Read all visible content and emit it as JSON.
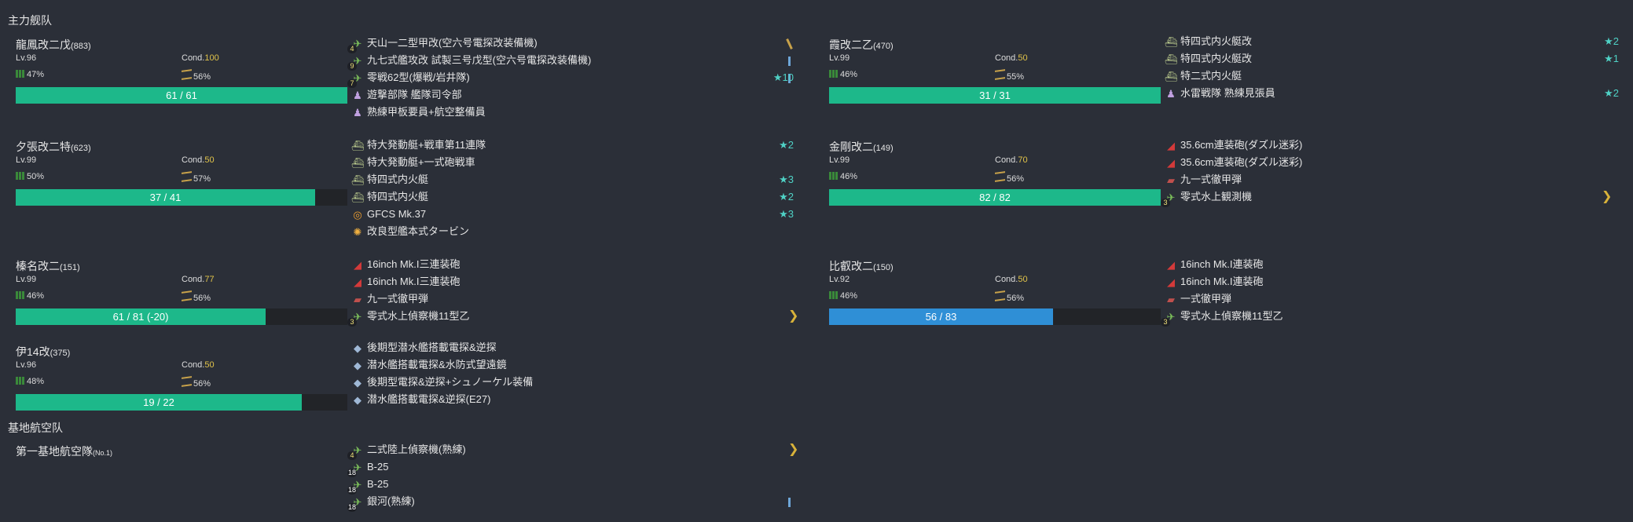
{
  "sections": {
    "main_fleet": "主力舰队",
    "base_air": "基地航空队"
  },
  "ships": [
    {
      "name": "龍鳳改二戊",
      "id": "(883)",
      "lv": "Lv.96",
      "cond_label": "Cond.",
      "cond": "100",
      "fuel": "47%",
      "ammo": "56%",
      "hp_text": "61 / 61",
      "hp_fraction": 1.0,
      "hp_color": "green",
      "equip": [
        {
          "icon": "plane-icon",
          "slot": "4",
          "name": "天山一二型甲改(空六号電探改装備機)",
          "prof": "slash"
        },
        {
          "icon": "plane-icon",
          "slot": "9",
          "name": "九七式艦攻改 試製三号戊型(空六号電探改装備機)",
          "prof": "bar"
        },
        {
          "icon": "plane-icon",
          "slot": "7",
          "name": "零戦62型(爆戦/岩井隊)",
          "prof": "bar",
          "stars": "★10"
        },
        {
          "icon": "crew-icon",
          "name": "遊撃部隊 艦隊司令部"
        },
        {
          "icon": "crew-icon",
          "name": "熟練甲板要員+航空整備員"
        }
      ]
    },
    {
      "name": "夕張改二特",
      "id": "(623)",
      "lv": "Lv.99",
      "cond_label": "Cond.",
      "cond": "50",
      "fuel": "50%",
      "ammo": "57%",
      "hp_text": "37 / 41",
      "hp_fraction": 0.9024,
      "hp_color": "green",
      "equip": [
        {
          "icon": "boat-icon",
          "name": "特大発動艇+戦車第11連隊",
          "stars": "★2"
        },
        {
          "icon": "boat-icon",
          "name": "特大発動艇+一式砲戦車"
        },
        {
          "icon": "boat-icon",
          "name": "特四式内火艇",
          "stars": "★3"
        },
        {
          "icon": "boat-icon",
          "name": "特四式内火艇",
          "stars": "★2"
        },
        {
          "icon": "radar-icon",
          "name": "GFCS Mk.37",
          "stars": "★3"
        },
        {
          "icon": "engine-icon",
          "name": "改良型艦本式タービン"
        }
      ]
    },
    {
      "name": "榛名改二",
      "id": "(151)",
      "lv": "Lv.99",
      "cond_label": "Cond.",
      "cond": "77",
      "fuel": "46%",
      "ammo": "56%",
      "hp_text": "61 / 81 (-20)",
      "hp_fraction": 0.7531,
      "hp_color": "green",
      "equip": [
        {
          "icon": "gun-icon",
          "name": "16inch Mk.I三連装砲"
        },
        {
          "icon": "gun-icon",
          "name": "16inch Mk.I三連装砲"
        },
        {
          "icon": "shell-icon",
          "name": "九一式徹甲弾"
        },
        {
          "icon": "seaplane-icon",
          "slot": "3",
          "name": "零式水上偵察機11型乙",
          "prof": "chevron"
        }
      ]
    },
    {
      "name": "伊14改",
      "id": "(375)",
      "lv": "Lv.96",
      "cond_label": "Cond.",
      "cond": "50",
      "fuel": "48%",
      "ammo": "56%",
      "hp_text": "19 / 22",
      "hp_fraction": 0.8636,
      "hp_color": "green",
      "equip": [
        {
          "icon": "sonar-icon",
          "name": "後期型潜水艦搭載電探&逆探"
        },
        {
          "icon": "sonar-icon",
          "name": "潜水艦搭載電探&水防式望遠鏡"
        },
        {
          "icon": "sonar-icon",
          "name": "後期型電探&逆探+シュノーケル装備"
        },
        {
          "icon": "sonar-icon",
          "name": "潜水艦搭載電探&逆探(E27)"
        }
      ]
    },
    {
      "name": "霞改二乙",
      "id": "(470)",
      "lv": "Lv.99",
      "cond_label": "Cond.",
      "cond": "50",
      "fuel": "46%",
      "ammo": "55%",
      "hp_text": "31 / 31",
      "hp_fraction": 1.0,
      "hp_color": "green",
      "equip": [
        {
          "icon": "boat-icon",
          "name": "特四式内火艇改",
          "stars": "★2"
        },
        {
          "icon": "boat-icon",
          "name": "特四式内火艇改",
          "stars": "★1"
        },
        {
          "icon": "boat-icon",
          "name": "特二式内火艇"
        },
        {
          "icon": "crew-icon",
          "name": "水雷戦隊 熟練見張員",
          "stars": "★2"
        }
      ]
    },
    {
      "name": "金剛改二",
      "id": "(149)",
      "lv": "Lv.99",
      "cond_label": "Cond.",
      "cond": "70",
      "fuel": "46%",
      "ammo": "56%",
      "hp_text": "82 / 82",
      "hp_fraction": 1.0,
      "hp_color": "green",
      "equip": [
        {
          "icon": "gun-icon",
          "name": "35.6cm連装砲(ダズル迷彩)"
        },
        {
          "icon": "gun-icon",
          "name": "35.6cm連装砲(ダズル迷彩)"
        },
        {
          "icon": "shell-icon",
          "name": "九一式徹甲弾"
        },
        {
          "icon": "seaplane-icon",
          "slot": "3",
          "name": "零式水上観測機",
          "prof": "chevron"
        }
      ]
    },
    {
      "name": "比叡改二",
      "id": "(150)",
      "lv": "Lv.92",
      "cond_label": "Cond.",
      "cond": "50",
      "fuel": "46%",
      "ammo": "56%",
      "hp_text": "56 / 83",
      "hp_fraction": 0.6747,
      "hp_color": "blue",
      "equip": [
        {
          "icon": "gun-icon",
          "name": "16inch Mk.I連装砲"
        },
        {
          "icon": "gun-icon",
          "name": "16inch Mk.I連装砲"
        },
        {
          "icon": "shell-icon",
          "name": "一式徹甲弾"
        },
        {
          "icon": "seaplane-icon",
          "slot": "3",
          "name": "零式水上偵察機11型乙"
        }
      ]
    }
  ],
  "air_base": {
    "name": "第一基地航空隊",
    "sub": "(No.1)",
    "equip": [
      {
        "icon": "plane-icon",
        "slot": "4",
        "name": "二式陸上偵察機(熟練)",
        "prof": "chevron"
      },
      {
        "icon": "plane-icon",
        "slot": "18",
        "name": "B-25"
      },
      {
        "icon": "plane-icon",
        "slot": "18",
        "name": "B-25"
      },
      {
        "icon": "plane-icon",
        "slot": "18",
        "name": "銀河(熟練)",
        "prof": "bar"
      }
    ]
  },
  "icon_glyphs": {
    "plane-icon": "✈",
    "seaplane-icon": "✈",
    "boat-icon": "⛴",
    "gun-icon": "◢",
    "shell-icon": "▰",
    "radar-icon": "◎",
    "sonar-icon": "◆",
    "crew-icon": "♟",
    "engine-icon": "✺"
  },
  "colors": {
    "hp_green": "#1db88a",
    "hp_blue": "#2f8fd6",
    "stars": "#4fd1c5",
    "cond": "#e0c34a"
  }
}
